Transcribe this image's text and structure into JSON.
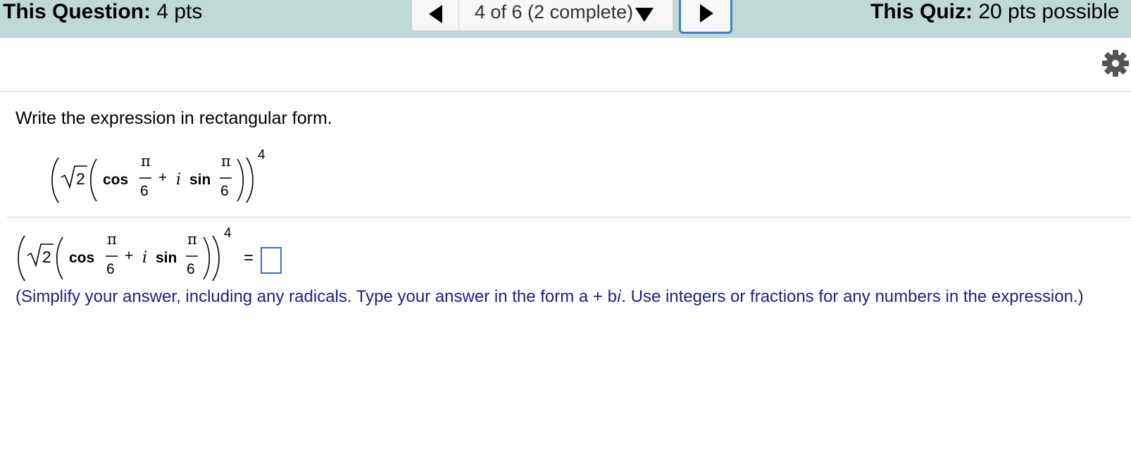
{
  "header": {
    "question_label": "This Question:",
    "question_points": "4 pts",
    "quiz_label": "This Quiz:",
    "quiz_points": "20 pts possible",
    "navigation": {
      "position_text": "4 of 6 (2 complete)"
    }
  },
  "question": {
    "instruction": "Write the expression in rectangular form.",
    "expression": {
      "radicand": "2",
      "cos_label": "cos",
      "sin_label": "sin",
      "imag_unit": "i",
      "plus": "+",
      "numerator": "π",
      "denominator": "6",
      "exponent": "4"
    },
    "answer_equals": "=",
    "answer_value": "",
    "hint_text": "(Simplify your answer, including any radicals. Type your answer in the form a + b𝑖. Use integers or fractions for any numbers in the expression.)"
  },
  "colors": {
    "header_bg": "#bfd9d6",
    "hint_text": "#1c1f8a",
    "focus_border": "#3b7fc4",
    "separator": "#c9ced6"
  },
  "icons": [
    "prev-arrow-icon",
    "dropdown-arrow-icon",
    "next-arrow-icon",
    "gear-icon"
  ]
}
